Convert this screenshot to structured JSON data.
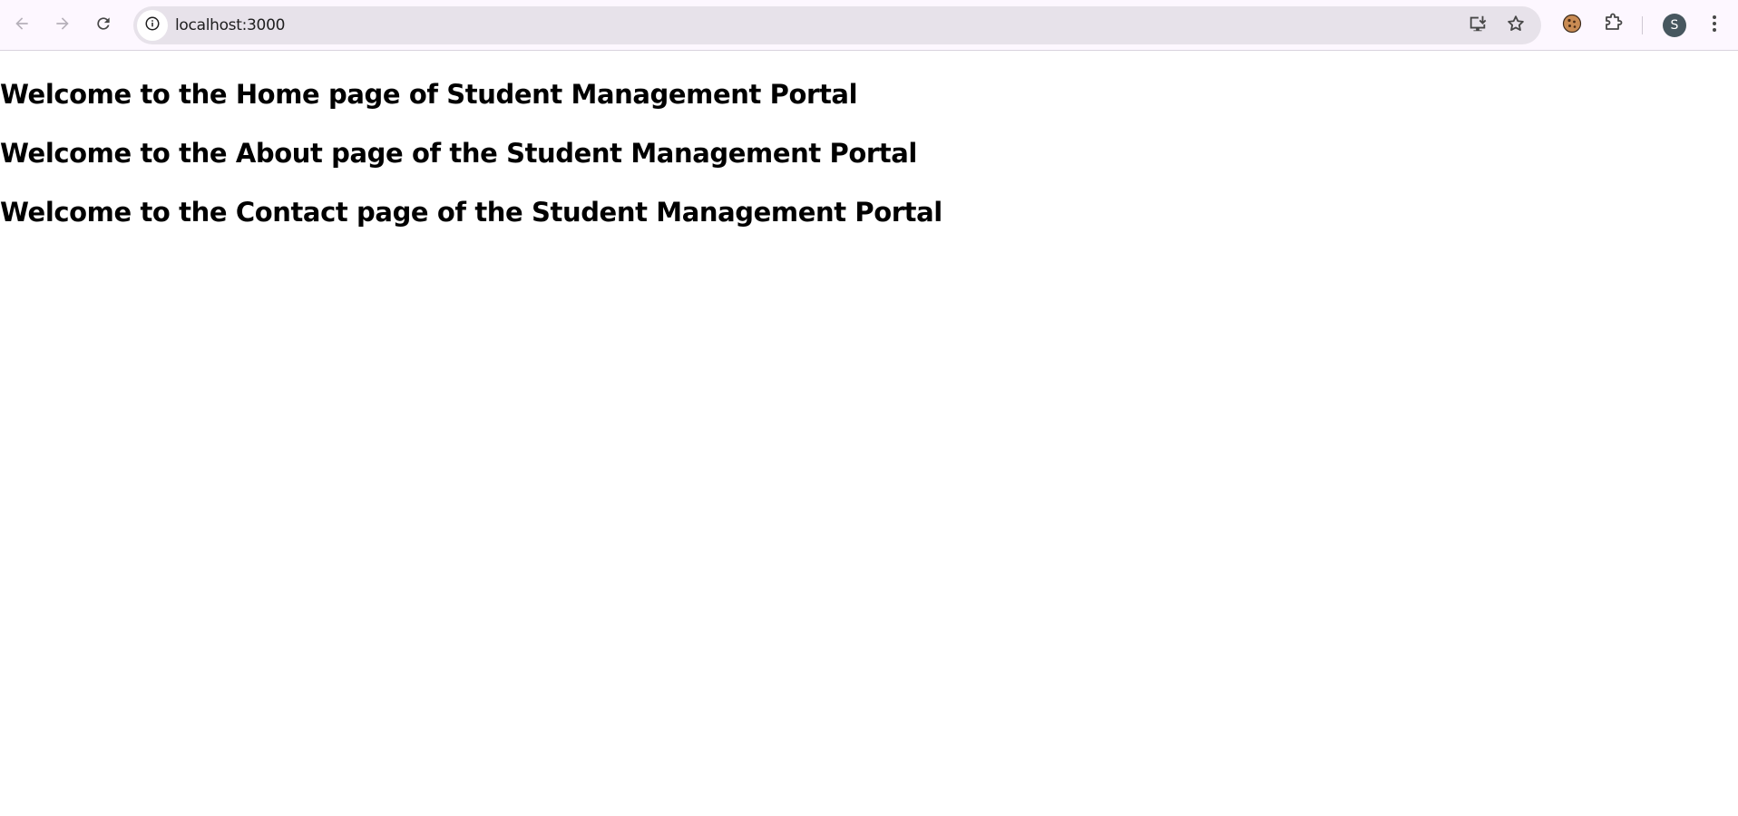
{
  "browser": {
    "url": "localhost:3000",
    "profile_initial": "S",
    "icons": {
      "back": "arrow-left-icon",
      "forward": "arrow-right-icon",
      "reload": "reload-icon",
      "site_info": "info-icon",
      "install": "install-app-icon",
      "bookmark": "star-icon",
      "extension_cookie": "cookie-icon",
      "extensions": "puzzle-icon",
      "menu": "kebab-menu-icon"
    }
  },
  "page": {
    "headings": [
      "Welcome to the Home page of Student Management Portal",
      "Welcome to the About page of the Student Management Portal",
      "Welcome to the Contact page of the Student Management Portal"
    ]
  },
  "colors": {
    "toolbar_bg": "#fdf7ff",
    "omnibox_bg": "#e7e2ea",
    "avatar_bg": "#47575f",
    "text": "#000000"
  }
}
